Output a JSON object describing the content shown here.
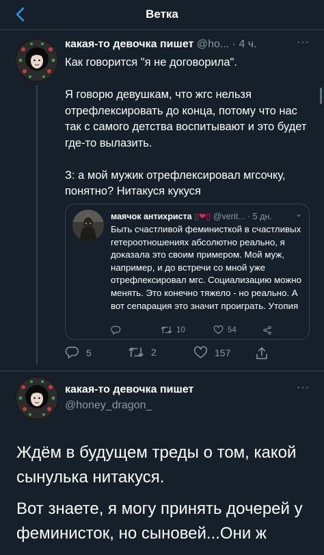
{
  "header": {
    "title": "Ветка"
  },
  "tweet1": {
    "author_name": "какая-то девочка пишет",
    "author_handle": "@ho...",
    "separator": "·",
    "time": "4 ч.",
    "more": "···",
    "paragraphs": [
      "Как говорится \"я не договорила\".",
      "Я говорю девушкам, что жгс нельзя отрефлексировать до конца, потому что нас так с самого детства воспитывают и это будет где-то вылазить.",
      "З: а мой мужик отрефлексировал мгсочку, понятно? Нитакуся кукуся"
    ],
    "quote": {
      "author_name": "маячок антихриста",
      "author_emoji": "▯❤▯",
      "author_handle": "@verit...",
      "separator": "·",
      "time": "5 дн.",
      "more": "⌄",
      "text": "Быть счастливой феминисткой в счастливых гетероотношениях абсолютно реально, я доказала это своим примером. Мой муж, например, и до встречи со мной уже отрефлексировал мгс. Социализацию можно менять. Это конечно тяжело - но реально. А вот сепарация это значит проиграть. Утопия",
      "stats": {
        "replies": "",
        "retweets": "10",
        "likes": "54"
      }
    },
    "stats": {
      "replies": "5",
      "retweets": "2",
      "likes": "157"
    }
  },
  "tweet2": {
    "author_name": "какая-то девочка пишет",
    "author_handle": "@honey_dragon_",
    "more": "···",
    "paragraphs": [
      "Ждём в будущем треды о том, какой сынулька нитакуся.",
      "Вот знаете, я могу принять дочерей у феминисток, но сыновей...Они ж"
    ]
  },
  "colors": {
    "background": "#15202b",
    "accent": "#1da1f2",
    "secondary_text": "#8899a6",
    "border": "#38444d"
  }
}
